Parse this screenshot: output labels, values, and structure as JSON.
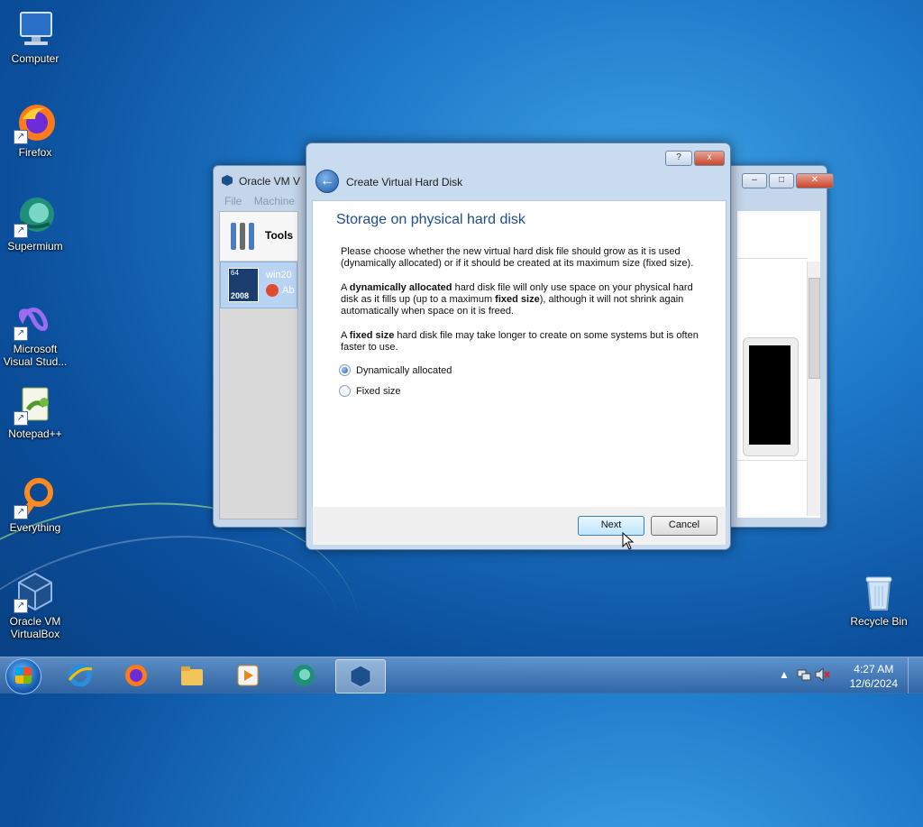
{
  "desktop": {
    "icons": [
      {
        "label": "Computer"
      },
      {
        "label": "Firefox"
      },
      {
        "label": "Supermium"
      },
      {
        "label": "Microsoft Visual Stud..."
      },
      {
        "label": "Notepad++"
      },
      {
        "label": "Everything"
      },
      {
        "label": "Oracle VM VirtualBox"
      },
      {
        "label": "Recycle Bin"
      }
    ]
  },
  "vbox_window": {
    "title": "Oracle VM V",
    "menu": [
      "File",
      "Machine"
    ],
    "tools_label": "Tools",
    "vm_name": "win20",
    "vm_state": "Ab",
    "vm_badge_top": "64",
    "vm_badge_bottom": "2008"
  },
  "dialog": {
    "title": "Create Virtual Hard Disk",
    "heading": "Storage on physical hard disk",
    "para1": "Please choose whether the new virtual hard disk file should grow as it is used (dynamically allocated) or if it should be created at its maximum size (fixed size).",
    "para2_prefix": "A ",
    "para2_bold1": "dynamically allocated",
    "para2_mid": " hard disk file will only use space on your physical hard disk as it fills up (up to a maximum ",
    "para2_bold2": "fixed size",
    "para2_suffix": "), although it will not shrink again automatically when space on it is freed.",
    "para3_prefix": "A ",
    "para3_bold": "fixed size",
    "para3_suffix": " hard disk file may take longer to create on some systems but is often faster to use.",
    "options": [
      {
        "label": "Dynamically allocated",
        "selected": true
      },
      {
        "label": "Fixed size",
        "selected": false
      }
    ],
    "next_label": "Next",
    "cancel_label": "Cancel",
    "help_glyph": "?",
    "close_glyph": "x"
  },
  "taskbar": {
    "time": "4:27 AM",
    "date": "12/6/2024"
  }
}
